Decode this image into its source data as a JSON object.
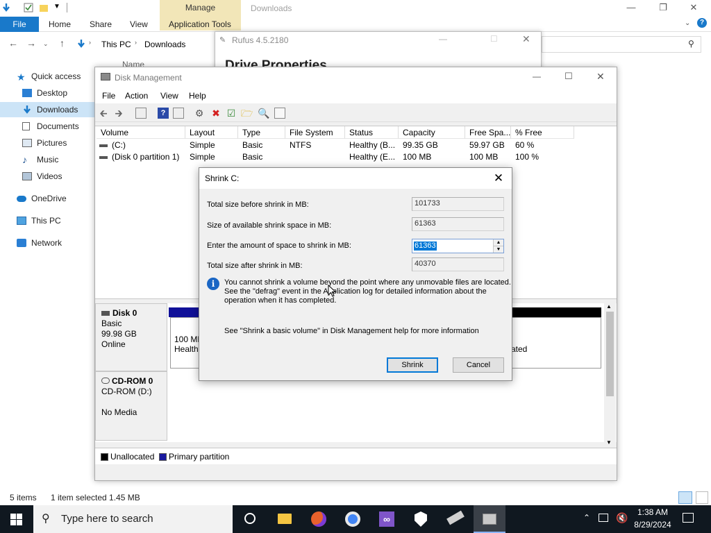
{
  "explorer": {
    "window_title": "Downloads",
    "contextual_tab": "Manage",
    "ribbon_tabs": [
      "File",
      "Home",
      "Share",
      "View",
      "Application Tools"
    ],
    "breadcrumb": [
      "This PC",
      "Downloads"
    ],
    "column_header": "Name",
    "nav": [
      {
        "label": "Quick access",
        "icon": "star-icon"
      },
      {
        "label": "Desktop",
        "icon": "desktop-icon"
      },
      {
        "label": "Downloads",
        "icon": "download-icon",
        "selected": true
      },
      {
        "label": "Documents",
        "icon": "document-icon"
      },
      {
        "label": "Pictures",
        "icon": "pictures-icon"
      },
      {
        "label": "Music",
        "icon": "music-icon"
      },
      {
        "label": "Videos",
        "icon": "videos-icon"
      },
      {
        "label": "OneDrive",
        "icon": "cloud-icon"
      },
      {
        "label": "This PC",
        "icon": "computer-icon"
      },
      {
        "label": "Network",
        "icon": "network-icon"
      }
    ],
    "status": {
      "items": "5 items",
      "selection": "1 item selected  1.45 MB"
    }
  },
  "rufus": {
    "title": "Rufus 4.5.2180",
    "heading": "Drive Properties"
  },
  "disk_management": {
    "title": "Disk Management",
    "menu": [
      "File",
      "Action",
      "View",
      "Help"
    ],
    "columns": [
      "Volume",
      "Layout",
      "Type",
      "File System",
      "Status",
      "Capacity",
      "Free Spa...",
      "% Free"
    ],
    "rows": [
      [
        "(C:)",
        "Simple",
        "Basic",
        "NTFS",
        "Healthy (B...",
        "99.35 GB",
        "59.97 GB",
        "60 %"
      ],
      [
        "(Disk 0 partition 1)",
        "Simple",
        "Basic",
        "",
        "Healthy (E...",
        "100 MB",
        "100 MB",
        "100 %"
      ]
    ],
    "disk0": {
      "name": "Disk 0",
      "type": "Basic",
      "size": "99.98 GB",
      "state": "Online",
      "part1_size": "100 MB",
      "part1_status": "Healthy",
      "part2_tail": "ated"
    },
    "cdrom": {
      "name": "CD-ROM 0",
      "drive": "CD-ROM (D:)",
      "media": "No Media"
    },
    "legend": [
      {
        "label": "Unallocated",
        "color": "#000000"
      },
      {
        "label": "Primary partition",
        "color": "#1a1aa0"
      }
    ]
  },
  "shrink_dialog": {
    "title": "Shrink C:",
    "fields": [
      {
        "label": "Total size before shrink in MB:",
        "value": "101733"
      },
      {
        "label": "Size of available shrink space in MB:",
        "value": "61363"
      },
      {
        "label": "Enter the amount of space to shrink in MB:",
        "value": "61363"
      },
      {
        "label": "Total size after shrink in MB:",
        "value": "40370"
      }
    ],
    "info_lines": [
      "You cannot shrink a volume beyond the point where any unmovable files are located.",
      "See the \"defrag\" event in the Application log for detailed information about the",
      "operation when it has completed."
    ],
    "help_text": "See \"Shrink a basic volume\" in Disk Management help for more information",
    "shrink_button": "Shrink",
    "cancel_button": "Cancel"
  },
  "taskbar": {
    "search_placeholder": "Type here to search",
    "time": "1:38 AM",
    "date": "8/29/2024"
  }
}
